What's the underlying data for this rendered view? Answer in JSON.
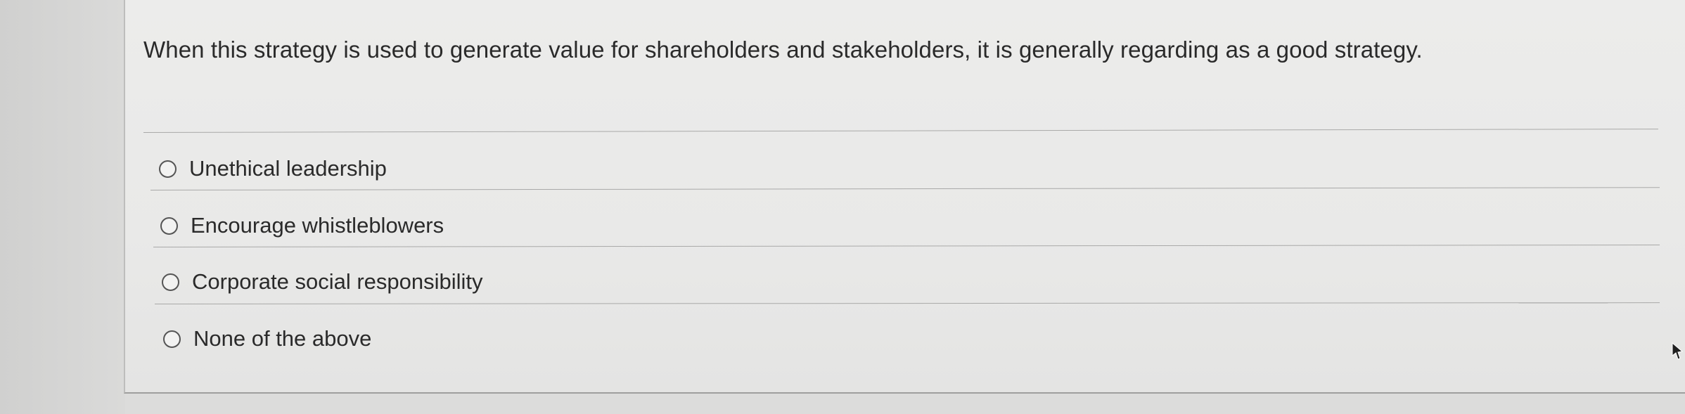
{
  "question": {
    "text": "When this strategy is used to generate value for shareholders and stakeholders, it is generally regarding as a good strategy."
  },
  "options": [
    {
      "label": "Unethical leadership",
      "selected": false
    },
    {
      "label": "Encourage whistleblowers",
      "selected": false
    },
    {
      "label": "Corporate social responsibility",
      "selected": false
    },
    {
      "label": "None of the above",
      "selected": false
    }
  ],
  "icons": {
    "option_marker": "radio-button-icon",
    "pointer": "mouse-cursor-icon"
  }
}
